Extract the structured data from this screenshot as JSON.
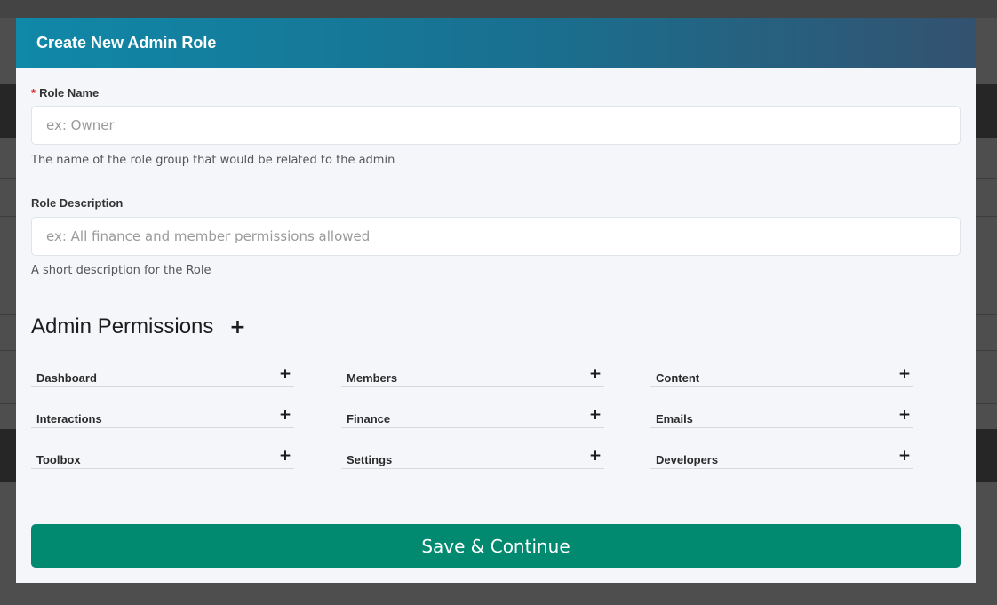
{
  "modal": {
    "title": "Create New Admin Role",
    "role_name": {
      "required_marker": "*",
      "label": "Role Name",
      "placeholder": "ex: Owner",
      "help": "The name of the role group that would be related to the admin"
    },
    "role_description": {
      "label": "Role Description",
      "placeholder": "ex: All finance and member permissions allowed",
      "help": "A short description for the Role"
    },
    "permissions": {
      "title": "Admin Permissions",
      "add_symbol": "+",
      "items": [
        {
          "label": "Dashboard"
        },
        {
          "label": "Members"
        },
        {
          "label": "Content"
        },
        {
          "label": "Interactions"
        },
        {
          "label": "Finance"
        },
        {
          "label": "Emails"
        },
        {
          "label": "Toolbox"
        },
        {
          "label": "Settings"
        },
        {
          "label": "Developers"
        }
      ]
    },
    "save_label": "Save & Continue"
  },
  "colors": {
    "header_start": "#1088a8",
    "header_end": "#335270",
    "save_button": "#018a6f",
    "required": "#e0262f",
    "modal_bg": "#f5f6fa"
  },
  "icons": {
    "add": "plus-icon"
  }
}
